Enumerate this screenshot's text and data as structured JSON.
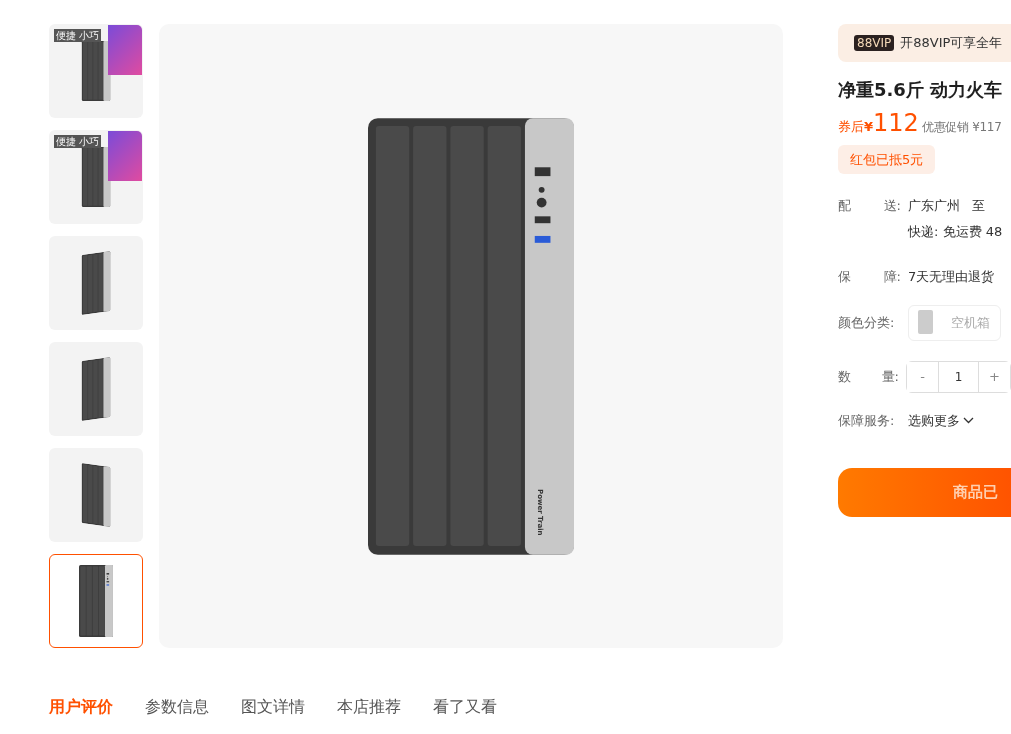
{
  "thumbnails": [
    {
      "kind": "monitor",
      "tag": "便捷 小巧",
      "selected": false
    },
    {
      "kind": "monitor",
      "tag": "便捷 小巧",
      "selected": false
    },
    {
      "kind": "side",
      "selected": false
    },
    {
      "kind": "side",
      "selected": false
    },
    {
      "kind": "angle",
      "selected": false
    },
    {
      "kind": "front",
      "selected": true
    }
  ],
  "main_image": {
    "brand": "Power Train"
  },
  "vip": {
    "badge": "88VIP",
    "text": "开88VIP可享全年"
  },
  "title": "净重5.6斤 动力火车",
  "price": {
    "prefix": "券后",
    "currency": "¥",
    "amount": "112",
    "promo": "优惠促销 ¥117"
  },
  "coupon": "红包已抵5元",
  "delivery": {
    "label_1": "配",
    "label_2": "送:",
    "from": "广东广州",
    "to": "至",
    "line_2": "快递: 免运费 48"
  },
  "guarantee": {
    "label_1": "保",
    "label_2": "障:",
    "text": "7天无理由退货"
  },
  "color": {
    "label": "颜色分类:",
    "option": "空机箱"
  },
  "quantity": {
    "label_1": "数",
    "label_2": "量:",
    "minus": "-",
    "value": "1",
    "plus": "+"
  },
  "service": {
    "label": "保障服务:",
    "link": "选购更多"
  },
  "buy_button": "商品已",
  "tabs": [
    {
      "label": "用户评价",
      "selected": true
    },
    {
      "label": "参数信息",
      "selected": false
    },
    {
      "label": "图文详情",
      "selected": false
    },
    {
      "label": "本店推荐",
      "selected": false
    },
    {
      "label": "看了又看",
      "selected": false
    }
  ]
}
